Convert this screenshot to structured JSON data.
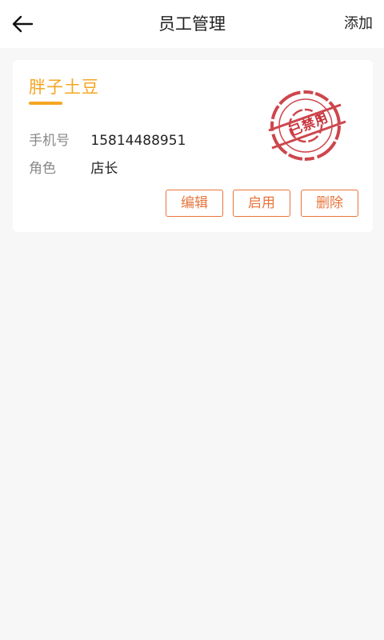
{
  "header": {
    "title": "员工管理",
    "action_label": "添加",
    "back_icon": "arrow-left-icon"
  },
  "employee": {
    "name": "胖子土豆",
    "phone_label": "手机号",
    "phone": "15814488951",
    "role_label": "角色",
    "role": "店长",
    "status_stamp": "已禁用",
    "actions": {
      "edit": "编辑",
      "enable": "启用",
      "delete": "删除"
    }
  },
  "colors": {
    "accent": "#f5a623",
    "button": "#e8743b",
    "stamp": "#c8323a",
    "background": "#f7f7f7"
  }
}
